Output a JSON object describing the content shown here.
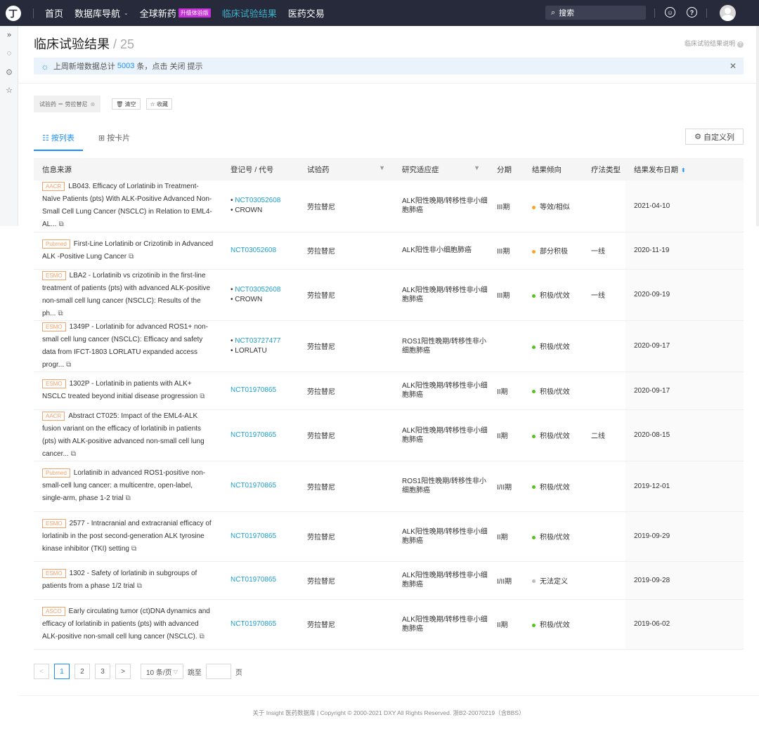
{
  "topbar": {
    "logo_char": "丁",
    "nav": [
      {
        "label": "首页"
      },
      {
        "label": "数据库导航",
        "caret": "⌄"
      },
      {
        "label": "全球新药",
        "badge": "升级体验版"
      },
      {
        "label": "临床试验结果",
        "active": true
      },
      {
        "label": "医药交易"
      }
    ],
    "search_placeholder": "搜索",
    "icon_help": "?"
  },
  "page": {
    "title": "临床试验结果",
    "separator": "/",
    "count": "25",
    "help_link": "临床试验结果说明"
  },
  "notice": {
    "prefix": "上周新增数据总计",
    "number": "5003",
    "suffix": "条，点击 关闭 提示"
  },
  "filter": {
    "tag": "试验药 ＝ 劳拉替尼",
    "clear_label": "清空",
    "save_label": "收藏"
  },
  "tabs": [
    {
      "label": "按列表",
      "active": true
    },
    {
      "label": "按卡片"
    }
  ],
  "custom_columns_label": "自定义列",
  "table": {
    "headers": [
      "信息来源",
      "登记号 / 代号",
      "试验药",
      "研究适应症",
      "分期",
      "结果倾向",
      "疗法类型",
      "结果发布日期"
    ],
    "rows": [
      {
        "tag": "AACR",
        "text": "LB043. Efficacy of Lorlatinib in Treatment-Naïve Patients (pts) With ALK-Positive Advanced Non-Small Cell Lung Cancer (NSCLC) in Relation to EML4-AL...",
        "reg": [
          "NCT03052608",
          "CROWN"
        ],
        "drug": "劳拉替尼",
        "indication": "ALK阳性晚期/转移性非小细胞肺癌",
        "phase": "III期",
        "trend": "等效/相似",
        "trend_color": "#f5a623",
        "therapy": "",
        "date": "2021-04-10",
        "h": 73
      },
      {
        "tag": "Pubmed",
        "text": "First-Line Lorlatinib or Crizotinib in Advanced ALK -Positive Lung Cancer",
        "reg": [
          "NCT03052608"
        ],
        "drug": "劳拉替尼",
        "indication": "ALK阳性非小细胞肺癌",
        "phase": "III期",
        "trend": "部分积极",
        "trend_color": "#f5a623",
        "therapy": "一线",
        "date": "2020-11-19",
        "h": 53
      },
      {
        "tag": "ESMO",
        "text": "LBA2 - Lorlatinib vs crizotinib in the first-line treatment of patients (pts) with advanced ALK-positive non-small cell lung cancer (NSCLC): Results of the ph...",
        "reg": [
          "NCT03052608",
          "CROWN"
        ],
        "drug": "劳拉替尼",
        "indication": "ALK阳性晚期/转移性非小细胞肺癌",
        "phase": "III期",
        "trend": "积极/优效",
        "trend_color": "#52c41a",
        "therapy": "一线",
        "date": "2020-09-19",
        "h": 73
      },
      {
        "tag": "ESMO",
        "text": "1349P - Lorlatinib for advanced ROS1+ non-small cell lung cancer (NSCLC): Efficacy and safety data from IFCT-1803 LORLATU expanded access progr...",
        "reg": [
          "NCT03727477",
          "LORLATU"
        ],
        "drug": "劳拉替尼",
        "indication": "ROS1阳性晚期/转移性非小细胞肺癌",
        "phase": "",
        "trend": "积极/优效",
        "trend_color": "#52c41a",
        "therapy": "",
        "date": "2020-09-17",
        "h": 72
      },
      {
        "tag": "ESMO",
        "text": "1302P - Lorlatinib in patients with ALK+ NSCLC treated beyond initial disease progression",
        "reg": [
          "NCT01970865"
        ],
        "drug": "劳拉替尼",
        "indication": "ALK阳性晚期/转移性非小细胞肺癌",
        "phase": "II期",
        "trend": "积极/优效",
        "trend_color": "#52c41a",
        "therapy": "",
        "date": "2020-09-17",
        "h": 54
      },
      {
        "tag": "AACR",
        "text": "Abstract CT025: Impact of the EML4-ALK fusion variant on the efficacy of lorlatinib in patients (pts) with ALK-positive advanced non-small cell lung cancer...",
        "reg": [
          "NCT01970865"
        ],
        "drug": "劳拉替尼",
        "indication": "ALK阳性晚期/转移性非小细胞肺癌",
        "phase": "II期",
        "trend": "积极/优效",
        "trend_color": "#52c41a",
        "therapy": "二线",
        "date": "2020-08-15",
        "h": 72
      },
      {
        "tag": "Pubmed",
        "text": "Lorlatinib in advanced ROS1-positive non-small-cell lung cancer: a multicentre, open-label, single-arm, phase 1-2 trial",
        "reg": [
          "NCT01970865"
        ],
        "drug": "劳拉替尼",
        "indication": "ROS1阳性晚期/转移性非小细胞肺癌",
        "phase": "I/II期",
        "trend": "积极/优效",
        "trend_color": "#52c41a",
        "therapy": "",
        "date": "2019-12-01",
        "h": 72
      },
      {
        "tag": "ESMO",
        "text": "2577 - Intracranial and extracranial efficacy of lorlatinib in the post second-generation ALK tyrosine kinase inhibitor (TKI) setting",
        "reg": [
          "NCT01970865"
        ],
        "drug": "劳拉替尼",
        "indication": "ALK阳性晚期/转移性非小细胞肺癌",
        "phase": "II期",
        "trend": "积极/优效",
        "trend_color": "#52c41a",
        "therapy": "",
        "date": "2019-09-29",
        "h": 71
      },
      {
        "tag": "ESMO",
        "text": "1302 - Safety of lorlatinib in subgroups of patients from a phase 1/2 trial",
        "reg": [
          "NCT01970865"
        ],
        "drug": "劳拉替尼",
        "indication": "ALK阳性晚期/转移性非小细胞肺癌",
        "phase": "I/II期",
        "trend": "无法定义",
        "trend_color": "#bbbbbb",
        "therapy": "",
        "date": "2019-09-28",
        "h": 54
      },
      {
        "tag": "ASCO",
        "text": "Early circulating tumor (ct)DNA dynamics and efficacy of lorlatinib in patients (pts) with advanced ALK-positive non-small cell lung cancer (NSCLC).",
        "reg": [
          "NCT01970865"
        ],
        "drug": "劳拉替尼",
        "indication": "ALK阳性晚期/转移性非小细胞肺癌",
        "phase": "II期",
        "trend": "积极/优效",
        "trend_color": "#52c41a",
        "therapy": "",
        "date": "2019-06-02",
        "h": 71
      }
    ]
  },
  "pagination": {
    "prev": "<",
    "pages": [
      "1",
      "2",
      "3"
    ],
    "next": ">",
    "page_size": "10 条/页",
    "jump_label": "跳至",
    "page_suffix": "页"
  },
  "footer": {
    "text": "关于 Insight 医药数据库 | Copyright © 2000-2021 DXY All Rights Reserved. 浙B2-20070219（含BBS）"
  }
}
